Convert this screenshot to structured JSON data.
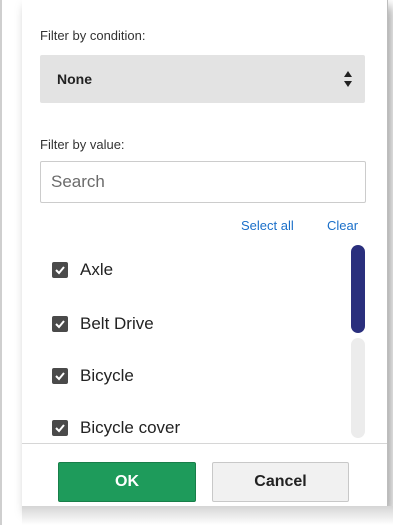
{
  "filter_condition": {
    "label": "Filter by condition:",
    "selected": "None"
  },
  "filter_value": {
    "label": "Filter by value:",
    "search_placeholder": "Search",
    "select_all": "Select all",
    "clear": "Clear",
    "items": [
      {
        "label": "Axle",
        "checked": true
      },
      {
        "label": "Belt Drive",
        "checked": true
      },
      {
        "label": "Bicycle",
        "checked": true
      },
      {
        "label": "Bicycle cover",
        "checked": true
      }
    ]
  },
  "buttons": {
    "ok": "OK",
    "cancel": "Cancel"
  },
  "colors": {
    "ok_button": "#1e9b5b",
    "link": "#1a6fc9",
    "scroll_thumb": "#2a2f7d"
  }
}
